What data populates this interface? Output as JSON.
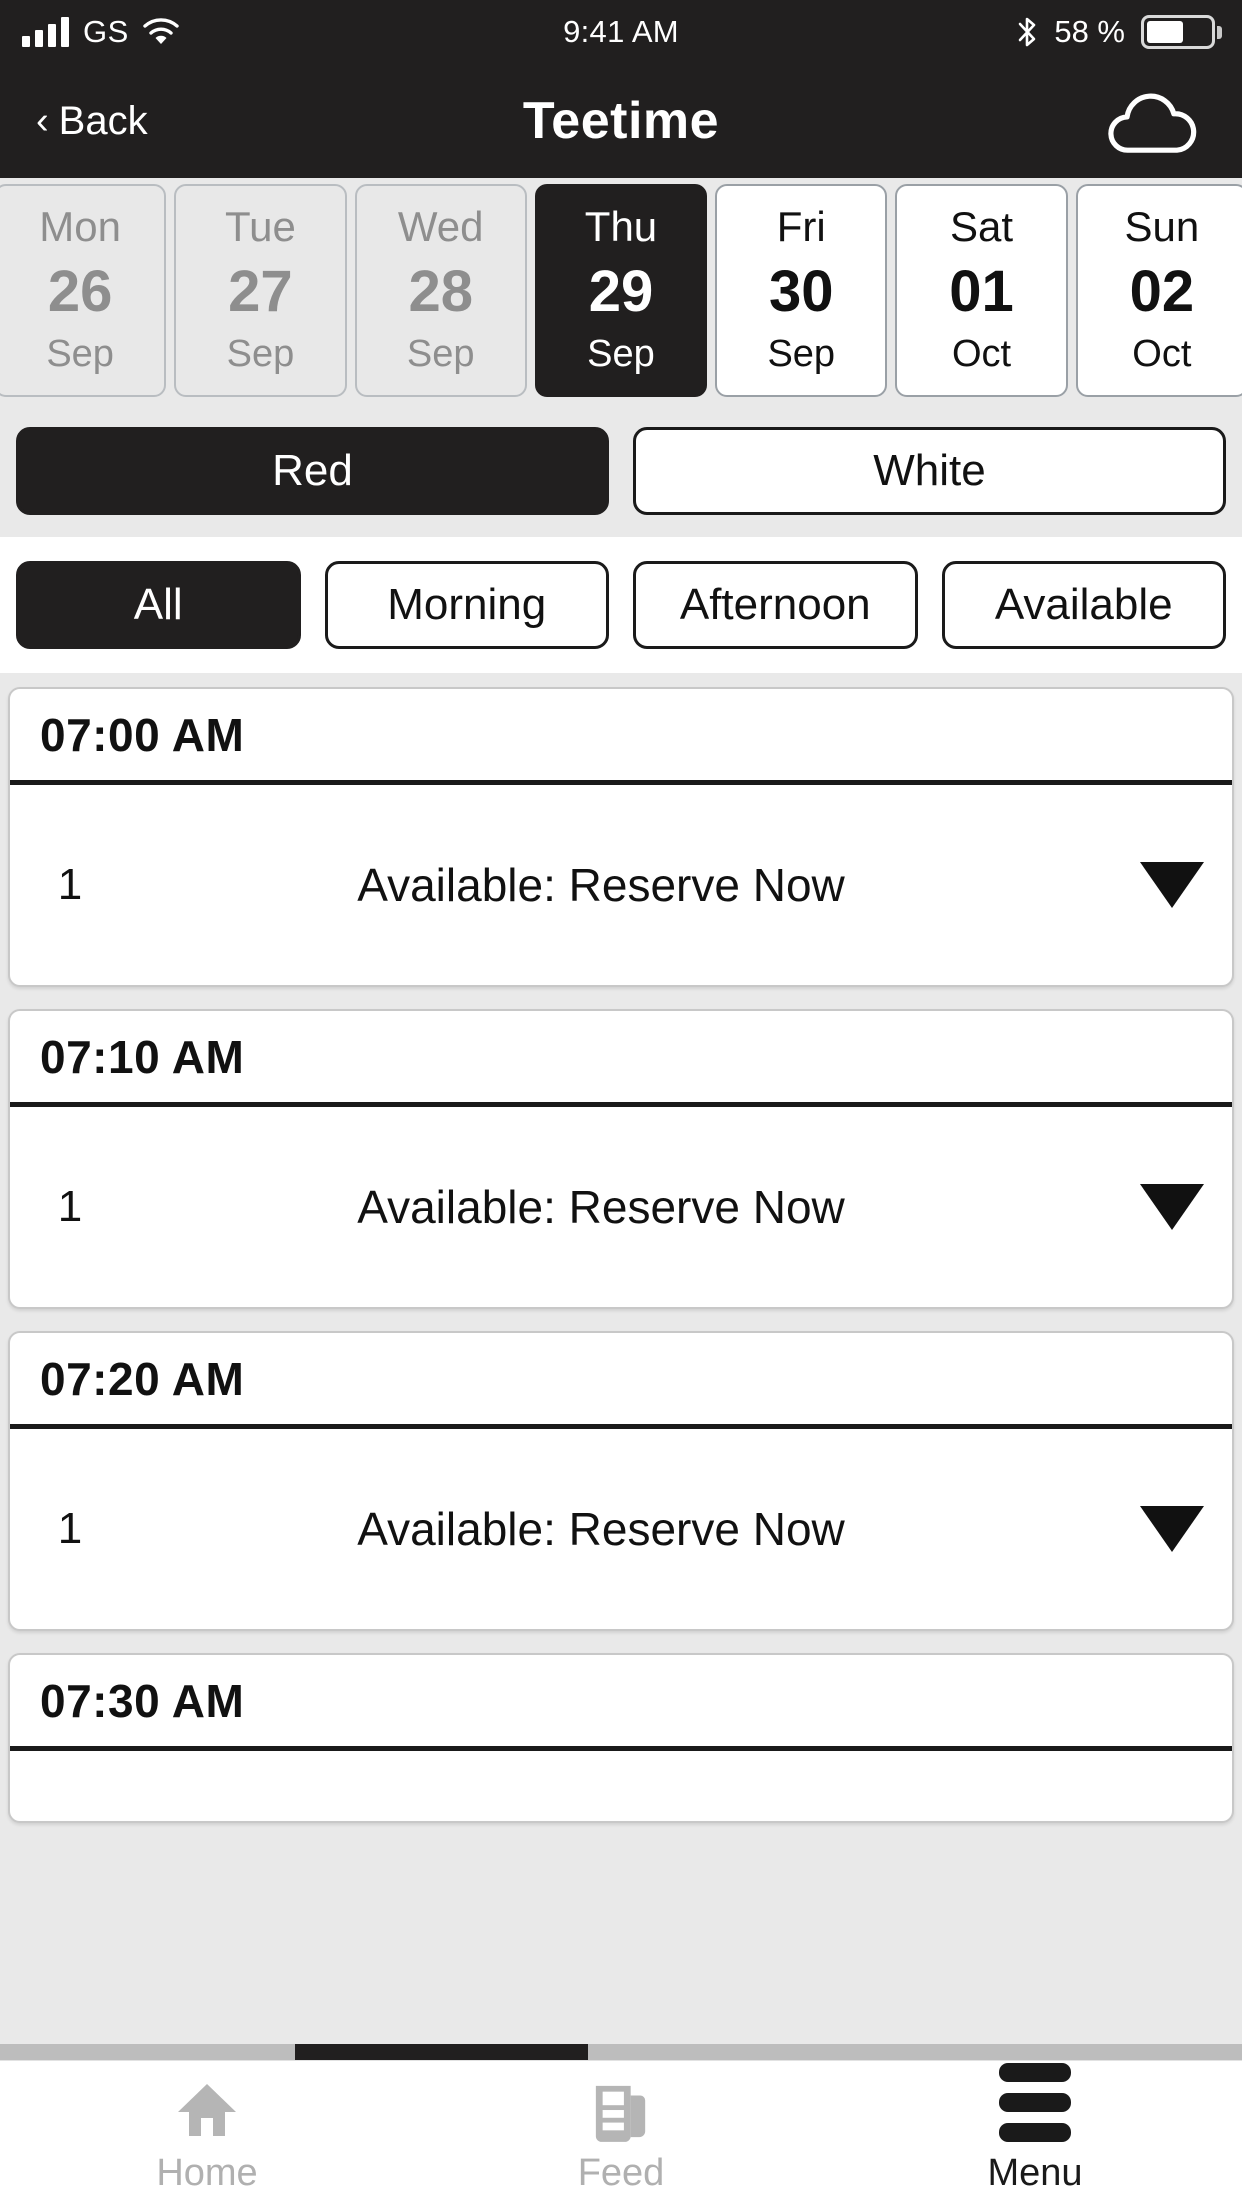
{
  "status_bar": {
    "carrier": "GS",
    "time": "9:41 AM",
    "battery_percent": "58 %",
    "battery_level": 58,
    "icons": [
      "signal-bars-icon",
      "wifi-icon",
      "bluetooth-icon",
      "battery-icon"
    ]
  },
  "header": {
    "back_label": "Back",
    "back_chevron": "‹",
    "title": "Teetime",
    "weather_icon": "cloud-icon"
  },
  "date_strip": {
    "days": [
      {
        "dow": "Mon",
        "num": "26",
        "month": "Sep",
        "state": "disabled"
      },
      {
        "dow": "Tue",
        "num": "27",
        "month": "Sep",
        "state": "disabled"
      },
      {
        "dow": "Wed",
        "num": "28",
        "month": "Sep",
        "state": "disabled"
      },
      {
        "dow": "Thu",
        "num": "29",
        "month": "Sep",
        "state": "selected"
      },
      {
        "dow": "Fri",
        "num": "30",
        "month": "Sep",
        "state": "enabled"
      },
      {
        "dow": "Sat",
        "num": "01",
        "month": "Oct",
        "state": "enabled"
      },
      {
        "dow": "Sun",
        "num": "02",
        "month": "Oct",
        "state": "enabled"
      }
    ]
  },
  "course_toggle": {
    "options": [
      {
        "label": "Red",
        "active": true
      },
      {
        "label": "White",
        "active": false
      }
    ]
  },
  "filters": {
    "options": [
      {
        "label": "All",
        "active": true
      },
      {
        "label": "Morning",
        "active": false
      },
      {
        "label": "Afternoon",
        "active": false
      },
      {
        "label": "Available",
        "active": false
      }
    ]
  },
  "teetimes": [
    {
      "time": "07:00 AM",
      "count": "1",
      "status": "Available: Reserve Now",
      "caret": "chevron-down-icon",
      "partial": false
    },
    {
      "time": "07:10 AM",
      "count": "1",
      "status": "Available: Reserve Now",
      "caret": "chevron-down-icon",
      "partial": false
    },
    {
      "time": "07:20 AM",
      "count": "1",
      "status": "Available: Reserve Now",
      "caret": "chevron-down-icon",
      "partial": false
    },
    {
      "time": "07:30 AM",
      "count": "",
      "status": "",
      "caret": "",
      "partial": true
    }
  ],
  "tabbar": {
    "tabs": [
      {
        "label": "Home",
        "icon": "home-icon",
        "active": false
      },
      {
        "label": "Feed",
        "icon": "feed-icon",
        "active": false
      },
      {
        "label": "Menu",
        "icon": "hamburger-menu-icon",
        "active": true
      }
    ]
  },
  "colors": {
    "dark": "#211f1f",
    "page_bg": "#e9e9e9",
    "card_bg": "#ffffff",
    "disabled_text": "#8e8e8e",
    "inactive_tab": "#b0b0b0"
  }
}
